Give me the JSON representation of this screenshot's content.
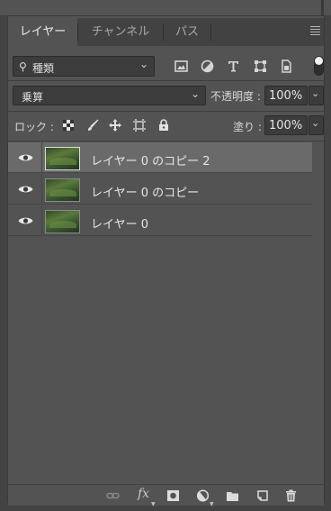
{
  "tabs": [
    {
      "label": "レイヤー",
      "active": true
    },
    {
      "label": "チャンネル",
      "active": false
    },
    {
      "label": "パス",
      "active": false
    }
  ],
  "filter": {
    "label": "種類",
    "icons": [
      "image-filter-icon",
      "adjustment-filter-icon",
      "type-filter-icon",
      "shape-filter-icon",
      "smart-object-filter-icon"
    ]
  },
  "blend": {
    "mode": "乗算",
    "opacity_label": "不透明度 :",
    "opacity_value": "100%"
  },
  "lock": {
    "label": "ロック :",
    "fill_label": "塗り :",
    "fill_value": "100%"
  },
  "layers": [
    {
      "name": "レイヤー 0 のコピー 2",
      "selected": true,
      "visible": true
    },
    {
      "name": "レイヤー 0 のコピー",
      "selected": false,
      "visible": true
    },
    {
      "name": "レイヤー 0",
      "selected": false,
      "visible": true
    }
  ],
  "footer": {
    "fx_label": "fx"
  },
  "colors": {
    "panel": "#535353",
    "selected_row": "#6a6a6a",
    "field": "#3c3c3c"
  }
}
